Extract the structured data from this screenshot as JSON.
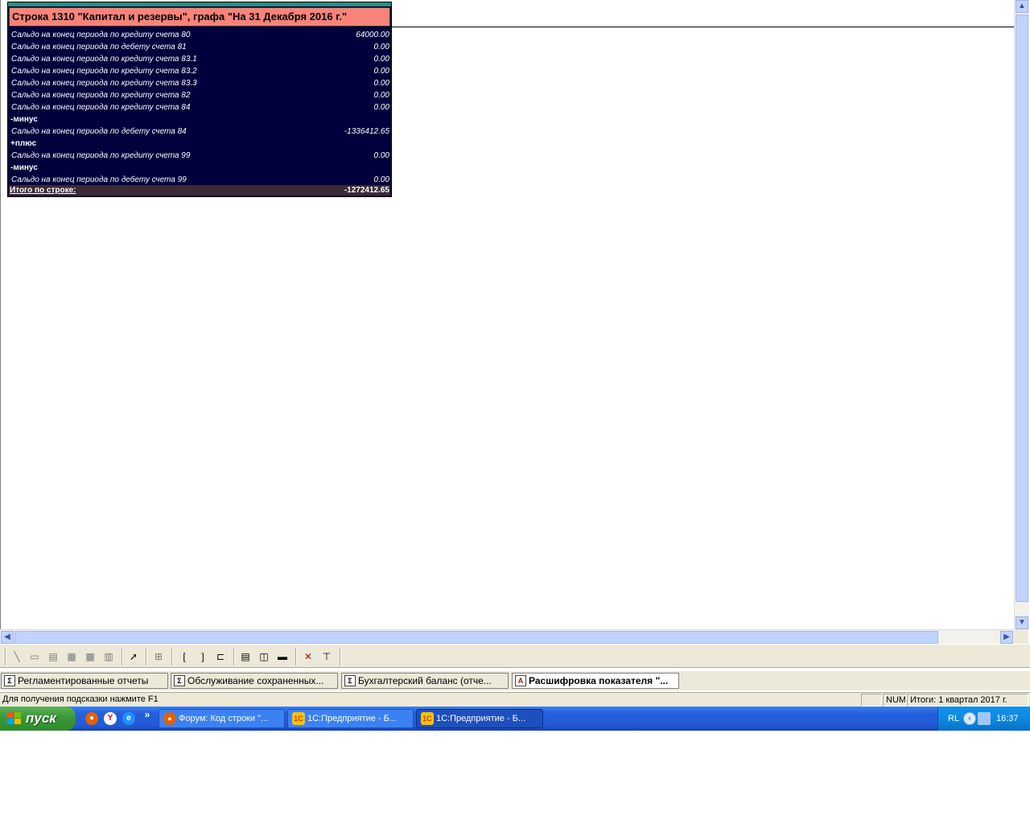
{
  "popup": {
    "title": "Строка 1310 \"Капитал и резервы\", графа \"На 31 Декабря 2016 г.\"",
    "rows": [
      {
        "label": "Сальдо на конец периода по кредиту счета 80",
        "value": "64000.00"
      },
      {
        "label": "Сальдо на конец периода по дебету счета 81",
        "value": "0.00"
      },
      {
        "label": "Сальдо на конец периода по кредиту счета 83.1",
        "value": "0.00"
      },
      {
        "label": "Сальдо на конец периода по кредиту счета 83.2",
        "value": "0.00"
      },
      {
        "label": "Сальдо на конец периода по кредиту счета 83.3",
        "value": "0.00"
      },
      {
        "label": "Сальдо на конец периода по кредиту счета 82",
        "value": "0.00"
      },
      {
        "label": "Сальдо на конец периода по кредиту счета 84",
        "value": "0.00"
      },
      {
        "label": "-минус",
        "value": ""
      },
      {
        "label": "Сальдо на конец периода по дебету счета 84",
        "value": "-1336412.65"
      },
      {
        "label": "+плюс",
        "value": ""
      },
      {
        "label": "Сальдо на конец периода по кредиту счета 99",
        "value": "0.00"
      },
      {
        "label": "-минус",
        "value": ""
      },
      {
        "label": "Сальдо на конец периода по дебету счета 99",
        "value": "0.00"
      }
    ],
    "total_label": "Итого по строке:",
    "total_value": "-1272412.65"
  },
  "window_tabs": [
    {
      "label": "Регламентированные отчеты",
      "icon": "sigma-icon"
    },
    {
      "label": "Обслуживание сохраненных...",
      "icon": "sigma-icon"
    },
    {
      "label": "Бухгалтерский баланс (отче...",
      "icon": "sigma-icon"
    },
    {
      "label": "Расшифровка показателя \"...",
      "icon": "report-icon"
    }
  ],
  "statusbar": {
    "hint": "Для получения подсказки нажмите F1",
    "num": "NUM",
    "period": "Итоги: 1 квартал 2017 г."
  },
  "taskbar": {
    "start_label": "пуск",
    "more": "»",
    "buttons": [
      {
        "label": "Форум: Код строки \"...",
        "icon": "firefox-icon"
      },
      {
        "label": "1С:Предприятие - Б...",
        "icon": "1c-icon"
      },
      {
        "label": "1С:Предприятие - Б...",
        "icon": "1c-icon"
      }
    ],
    "lang": "RL",
    "clock": "16:37"
  },
  "colors": {
    "popup_bg": "#00003c",
    "popup_header": "#f88379",
    "taskbar": "#245edc",
    "start": "#3c9a3a"
  }
}
